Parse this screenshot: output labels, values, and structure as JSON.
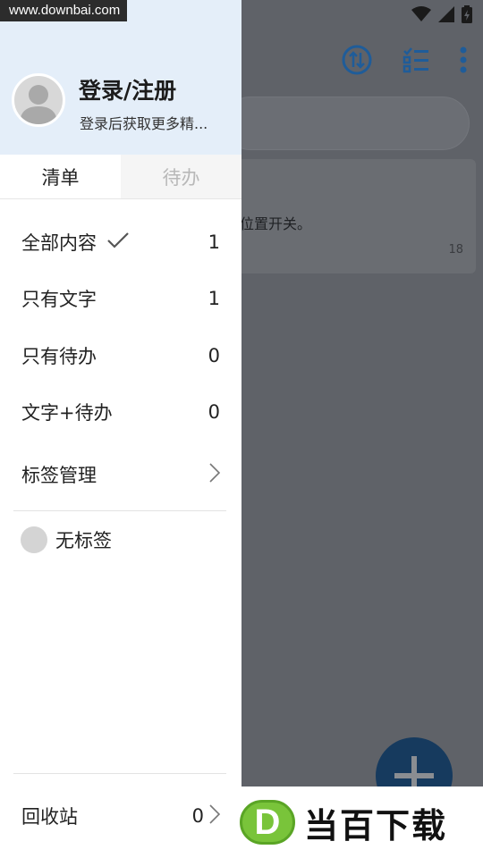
{
  "watermark": {
    "site": "www.downbai.com",
    "logo_letter": "D",
    "logo_text": "当百下载"
  },
  "background": {
    "card_text": "位置开关。",
    "card_number": "18"
  },
  "drawer": {
    "login_title": "登录/注册",
    "login_subtitle": "登录后获取更多精...",
    "tabs": [
      {
        "label": "清单"
      },
      {
        "label": "待办"
      }
    ],
    "items": [
      {
        "label": "全部内容",
        "count": "1",
        "selected": true
      },
      {
        "label": "只有文字",
        "count": "1"
      },
      {
        "label": "只有待办",
        "count": "0"
      },
      {
        "label": "文字+待办",
        "count": "0"
      }
    ],
    "tag_manage": "标签管理",
    "no_tag": "无标签",
    "trash": {
      "label": "回收站",
      "count": "0"
    }
  },
  "icons": {
    "status": [
      "wifi-icon",
      "signal-icon",
      "battery-icon"
    ],
    "toolbar": [
      "sort-icon",
      "checklist-icon",
      "more-vert-icon"
    ],
    "fab": "plus-icon"
  },
  "colors": {
    "accent": "#1f5c99",
    "header_bg": "#e4eef9",
    "scrim": "#5f6268"
  }
}
